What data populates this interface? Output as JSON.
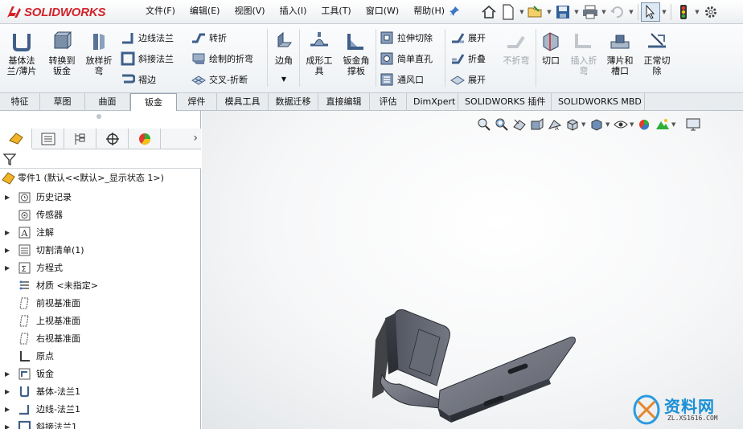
{
  "app": {
    "logo_text": "SOLIDWORKS",
    "brand_color": "#d2232a"
  },
  "menu": [
    {
      "label": "文件(F)"
    },
    {
      "label": "编辑(E)"
    },
    {
      "label": "视图(V)"
    },
    {
      "label": "插入(I)"
    },
    {
      "label": "工具(T)"
    },
    {
      "label": "窗口(W)"
    },
    {
      "label": "帮助(H)"
    }
  ],
  "quick_access": [
    "home-icon",
    "new-document-icon",
    "open-icon",
    "save-icon",
    "print-icon",
    "undo-icon",
    "select-pointer-icon",
    "traffic-light-icon",
    "options-gear-icon"
  ],
  "ribbon": {
    "base_flange": "基体法\n兰/薄片",
    "convert_to_sheet": "转换到\n钣金",
    "lofted_bend": "放样折\n弯",
    "edge_flange": "边线法兰",
    "miter_flange": "斜接法兰",
    "hem": "褶边",
    "jog": "转折",
    "sketched_bend": "绘制的折弯",
    "cross_break": "交叉-折断",
    "corner": "边角",
    "forming_tool": "成形工\n具",
    "sheet_metal_gusset": "钣金角\n撑板",
    "extruded_cut": "拉伸切除",
    "simple_hole": "简单直孔",
    "vent": "通风口",
    "unfold": "展开",
    "fold": "折叠",
    "flatten": "展开",
    "no_bends": "不折弯",
    "rip": "切口",
    "insert_bends": "插入折\n弯",
    "tab_and_slot": "薄片和\n槽口",
    "normal_cut": "正常切\n除"
  },
  "tabs": [
    {
      "label": "特征",
      "active": false
    },
    {
      "label": "草图",
      "active": false
    },
    {
      "label": "曲面",
      "active": false
    },
    {
      "label": "钣金",
      "active": true
    },
    {
      "label": "焊件",
      "active": false
    },
    {
      "label": "模具工具",
      "active": false
    },
    {
      "label": "数据迁移",
      "active": false
    },
    {
      "label": "直接编辑",
      "active": false
    },
    {
      "label": "评估",
      "active": false
    },
    {
      "label": "DimXpert",
      "active": false
    },
    {
      "label": "SOLIDWORKS 插件",
      "active": false
    },
    {
      "label": "SOLIDWORKS MBD",
      "active": false
    }
  ],
  "feature_tree": {
    "root": "零件1  (默认<<默认>_显示状态 1>)",
    "items": [
      {
        "label": "历史记录",
        "icon": "history-folder-icon",
        "expandable": true
      },
      {
        "label": "传感器",
        "icon": "sensor-icon",
        "expandable": false
      },
      {
        "label": "注解",
        "icon": "annotation-icon",
        "expandable": true
      },
      {
        "label": "切割清单(1)",
        "icon": "cut-list-icon",
        "expandable": true
      },
      {
        "label": "方程式",
        "icon": "equation-icon",
        "expandable": true
      },
      {
        "label": "材质 <未指定>",
        "icon": "material-icon",
        "expandable": false
      },
      {
        "label": "前视基准面",
        "icon": "plane-icon",
        "expandable": false
      },
      {
        "label": "上视基准面",
        "icon": "plane-icon",
        "expandable": false
      },
      {
        "label": "右视基准面",
        "icon": "plane-icon",
        "expandable": false
      },
      {
        "label": "原点",
        "icon": "origin-icon",
        "expandable": false
      },
      {
        "label": "钣金",
        "icon": "sheet-metal-icon",
        "expandable": true
      },
      {
        "label": "基体-法兰1",
        "icon": "base-flange-icon",
        "expandable": true
      },
      {
        "label": "边线-法兰1",
        "icon": "edge-flange-icon",
        "expandable": true
      },
      {
        "label": "斜接法兰1",
        "icon": "miter-flange-icon",
        "expandable": true
      }
    ]
  },
  "watermark": {
    "title": "资料网",
    "subtitle": "ZL.XS1616.COM"
  }
}
